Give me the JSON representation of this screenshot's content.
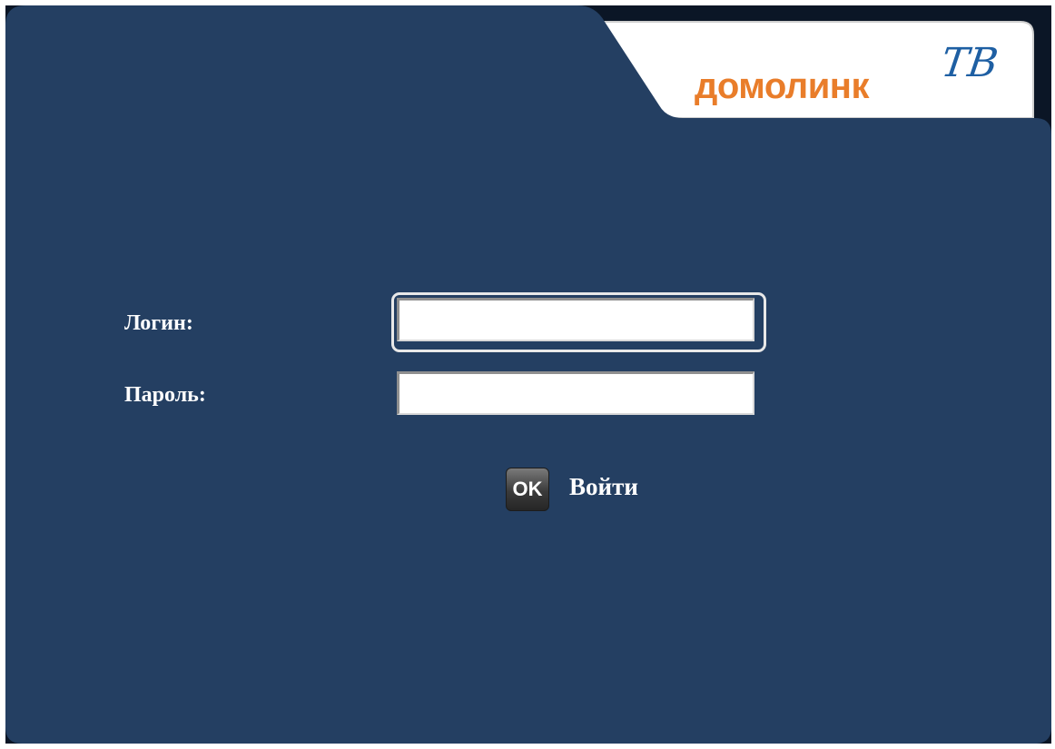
{
  "colors": {
    "panel": "#243f62",
    "accent_orange": "#e97d2a",
    "accent_blue": "#1e5fa3",
    "label_text": "#ffffff"
  },
  "logo": {
    "wordmark": "домолинк",
    "tv_mark": "ТВ"
  },
  "login_form": {
    "login_label": "Логин:",
    "login_value": "",
    "password_label": "Пароль:",
    "password_value": "",
    "submit_key_icon": "ok-key-icon",
    "submit_key_text": "OK",
    "submit_label": "Войти"
  }
}
